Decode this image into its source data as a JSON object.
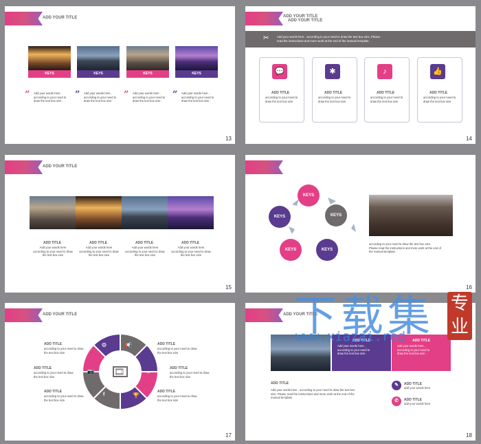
{
  "slide_numbers": {
    "s13": "13",
    "s14": "14",
    "s15": "15",
    "s16": "16",
    "s17": "17",
    "s18": "18"
  },
  "titles": {
    "add_your_title": "ADD YOUR TITLE",
    "add_title": "ADD TITLE",
    "keys": "KEYS"
  },
  "s13": {
    "texts": [
      "Add your words here ,",
      "according to your need to",
      "draw the text box size ."
    ]
  },
  "s14": {
    "header_line1": "Add your words here , according  to your need to draw the text box size, Please",
    "header_line2": "read  the instructions and more work at the end of the manual template.",
    "card_text": [
      "according to your need to",
      "draw the text box size"
    ]
  },
  "s15": {
    "text": [
      "Add your words here",
      "according to your need to draw",
      "the text box size"
    ]
  },
  "s16": {
    "text": [
      "according  to your need to draw  the text box size,",
      "Please read the instructions  and more work at the end of",
      "the manual template ."
    ]
  },
  "s17": {
    "text": [
      "according to your need to draw",
      "the text box size"
    ]
  },
  "s18": {
    "box_text": [
      "Add your words here ,",
      "according to your need to",
      "draw the text box size ."
    ],
    "body_line1": "Add your words here , according  to your need to draw the text box",
    "body_line2": "size, Please read the instructions and more work at the end of the",
    "body_line3": "manual  template.",
    "side_text": "add your words here"
  },
  "watermark": {
    "chinese": "下载集",
    "url": "www.xiazai.red",
    "seal": "专业"
  },
  "colors": {
    "pink": "#e33f86",
    "purple": "#5a3b8f",
    "gray": "#6f6a6b",
    "background": "#8a8a8e"
  }
}
